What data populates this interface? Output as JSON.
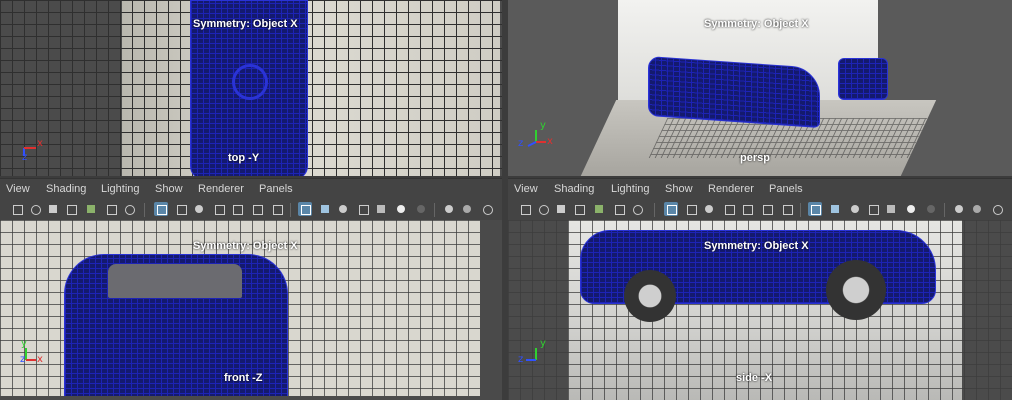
{
  "viewports": {
    "top": {
      "symmetry": "Symmetry: Object X",
      "camera": "top -Y"
    },
    "persp": {
      "symmetry": "Symmetry: Object X",
      "camera": "persp"
    },
    "front": {
      "symmetry": "Symmetry: Object X",
      "camera": "front -Z"
    },
    "side": {
      "symmetry": "Symmetry: Object X",
      "camera": "side -X"
    }
  },
  "axis_labels": {
    "x": "x",
    "y": "y",
    "z": "z"
  },
  "menu": [
    "View",
    "Shading",
    "Lighting",
    "Show",
    "Renderer",
    "Panels"
  ],
  "colors": {
    "wireframe": "#1d23b5",
    "selected_tool": "#5a86a8",
    "axis_x": "#e03030",
    "axis_y": "#30d030",
    "axis_z": "#3050ff"
  }
}
